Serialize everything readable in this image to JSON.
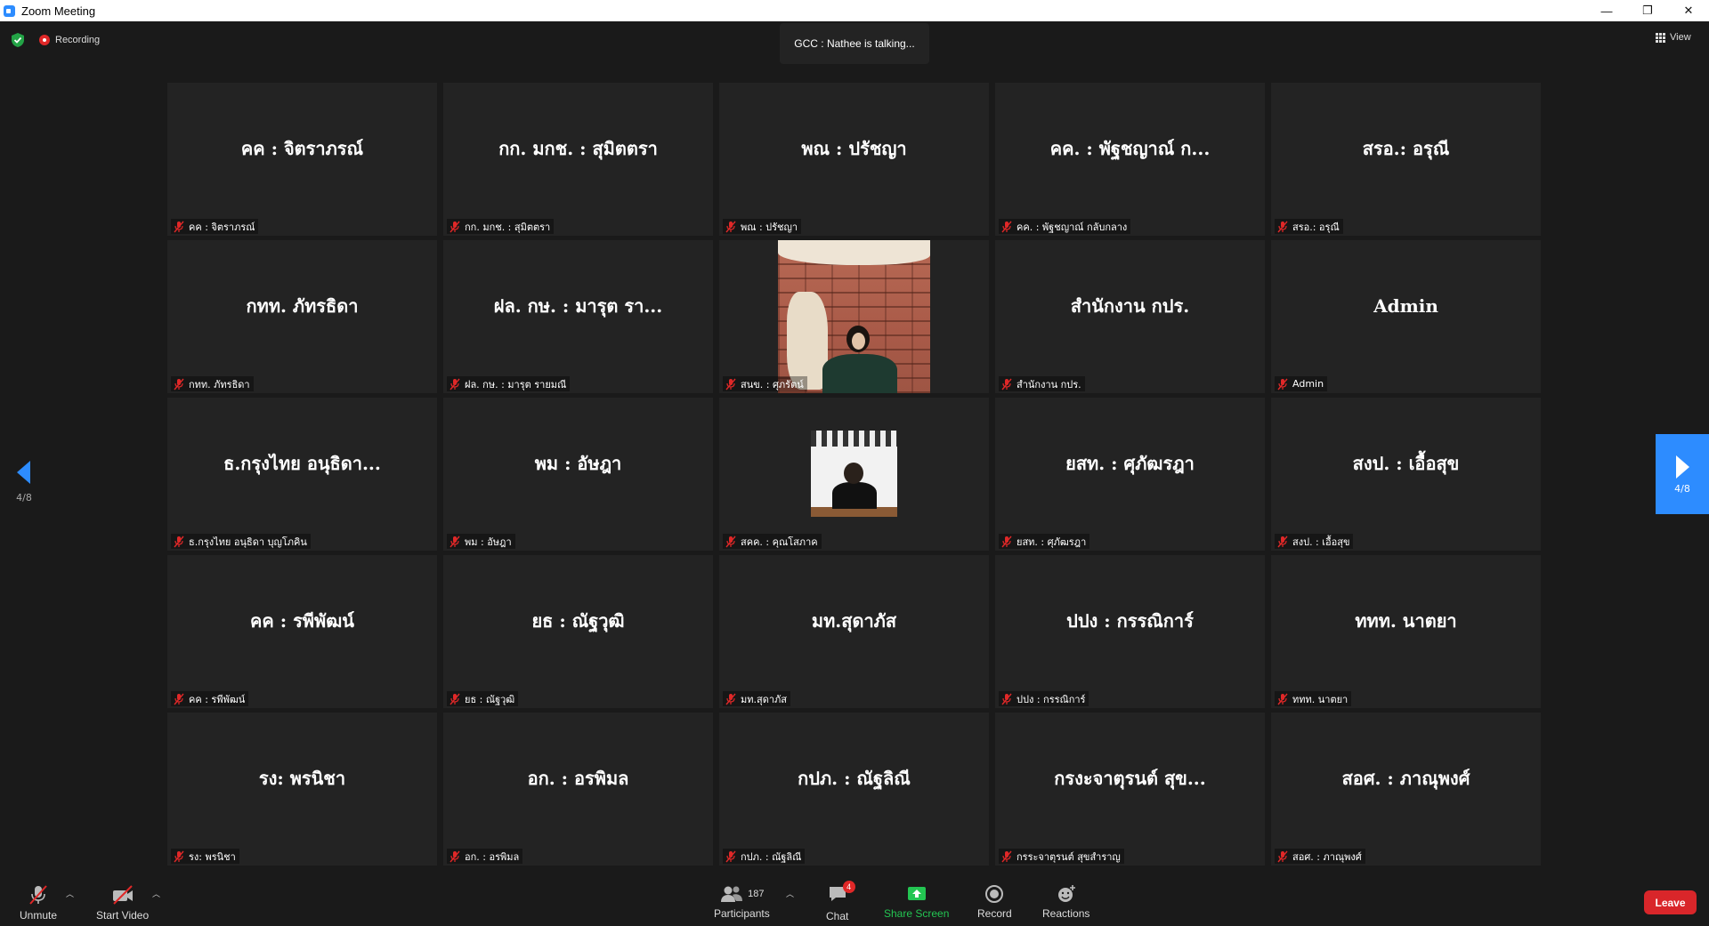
{
  "window": {
    "title": "Zoom Meeting",
    "controls": {
      "minimize": "—",
      "restore": "❐",
      "close": "✕"
    }
  },
  "topbar": {
    "recording_label": "Recording",
    "talking_indicator": "GCC : Nathee is talking...",
    "view_label": "View"
  },
  "pager": {
    "left_page": "4/8",
    "right_page": "4/8"
  },
  "tiles": [
    {
      "name": "คค : จิตราภรณ์",
      "caption": "คค : จิตราภรณ์"
    },
    {
      "name": "กก. มกช. : สุมิตตรา",
      "caption": "กก. มกช. : สุมิตตรา"
    },
    {
      "name": "พณ : ปรัชญา",
      "caption": "พณ : ปรัชญา"
    },
    {
      "name": "คค. : พัฐชญาณ์ ก...",
      "caption": "คค. : พัฐชญาณ์ กลับกลาง"
    },
    {
      "name": "สรอ.: อรุณี",
      "caption": "สรอ.: อรุณี"
    },
    {
      "name": "กทท. ภัทรธิดา",
      "caption": "กทท. ภัทรธิดา"
    },
    {
      "name": "ฝล. กษ. : มารุต รา...",
      "caption": "ฝล. กษ. : มารุต รายมณี"
    },
    {
      "name": "",
      "caption": "สนข. : ศุภรัตน์"
    },
    {
      "name": "สำนักงาน กปร.",
      "caption": "สำนักงาน กปร."
    },
    {
      "name": "Admin",
      "caption": "Admin"
    },
    {
      "name": "ธ.กรุงไทย อนุธิดา...",
      "caption": "ธ.กรุงไทย อนุธิดา บุญโภคิน"
    },
    {
      "name": "พม : อัษฎา",
      "caption": "พม : อัษฎา"
    },
    {
      "name": "",
      "caption": "สคค. : คุณโสภาค"
    },
    {
      "name": "ยสท. : ศุภัฒรฎา",
      "caption": "ยสท. : ศุภัฒรฎา"
    },
    {
      "name": "สงป. : เอื้อสุข",
      "caption": "สงป. : เอื้อสุข"
    },
    {
      "name": "คค : รพีพัฒน์",
      "caption": "คค : รพีพัฒน์"
    },
    {
      "name": "ยธ : ณัฐวุฒิ",
      "caption": "ยธ : ณัฐวุฒิ"
    },
    {
      "name": "มท.สุดาภัส",
      "caption": "มท.สุดาภัส"
    },
    {
      "name": "ปปง : กรรณิการ์",
      "caption": "ปปง : กรรณิการ์"
    },
    {
      "name": "ททท. นาตยา",
      "caption": "ททท. นาตยา"
    },
    {
      "name": "รง: พรนิชา",
      "caption": "รง: พรนิชา"
    },
    {
      "name": "อก. : อรพิมล",
      "caption": "อก. : อรพิมล"
    },
    {
      "name": "กปภ. : ณัฐลิณี",
      "caption": "กปภ. : ณัฐลิณี"
    },
    {
      "name": "กรงะจาตุรนต์ สุข...",
      "caption": "กรระจาตุรนต์ สุขสำราญ"
    },
    {
      "name": "สอศ. : ภาณุพงศ์",
      "caption": "สอศ. : ภาณุพงศ์"
    }
  ],
  "toolbar": {
    "unmute": "Unmute",
    "start_video": "Start Video",
    "participants": "Participants",
    "participants_count": "187",
    "chat": "Chat",
    "chat_badge": "4",
    "share_screen": "Share Screen",
    "record": "Record",
    "reactions": "Reactions",
    "leave": "Leave"
  }
}
